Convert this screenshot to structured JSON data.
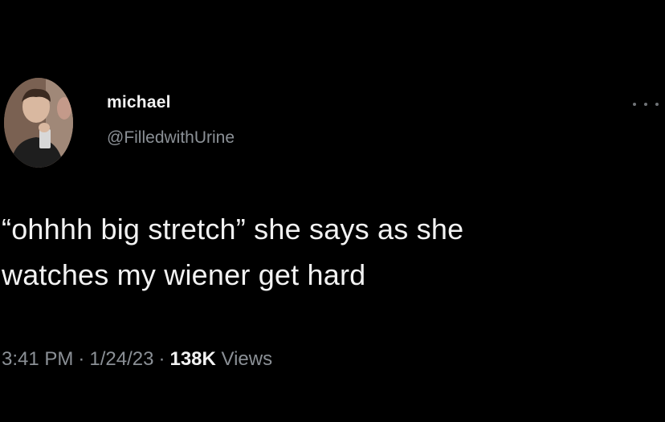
{
  "tweet": {
    "author": {
      "display_name": "michael",
      "handle": "@FilledwithUrine",
      "avatar_icon": "profile-photo"
    },
    "more_icon": "ellipsis-icon",
    "text_lines": [
      "“ohhhh big stretch” she says as she",
      "watches my wiener get hard"
    ],
    "meta": {
      "time": "3:41 PM",
      "date": "1/24/23",
      "separator": "·",
      "views_count": "138K",
      "views_label": "Views"
    }
  },
  "colors": {
    "background": "#000000",
    "primary_text": "#f2f2f2",
    "secondary_text": "#8b9096"
  }
}
